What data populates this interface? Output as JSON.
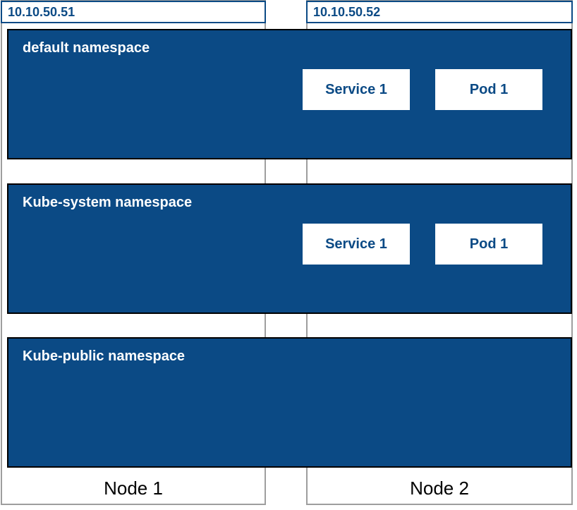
{
  "nodes": [
    {
      "ip": "10.10.50.51",
      "label": "Node 1"
    },
    {
      "ip": "10.10.50.52",
      "label": "Node 2"
    }
  ],
  "namespaces": [
    {
      "title": "default namespace",
      "resources": {
        "service": "Service 1",
        "pod": "Pod 1"
      }
    },
    {
      "title": "Kube-system namespace",
      "resources": {
        "service": "Service 1",
        "pod": "Pod 1"
      }
    },
    {
      "title": "Kube-public namespace",
      "resources": null
    }
  ]
}
